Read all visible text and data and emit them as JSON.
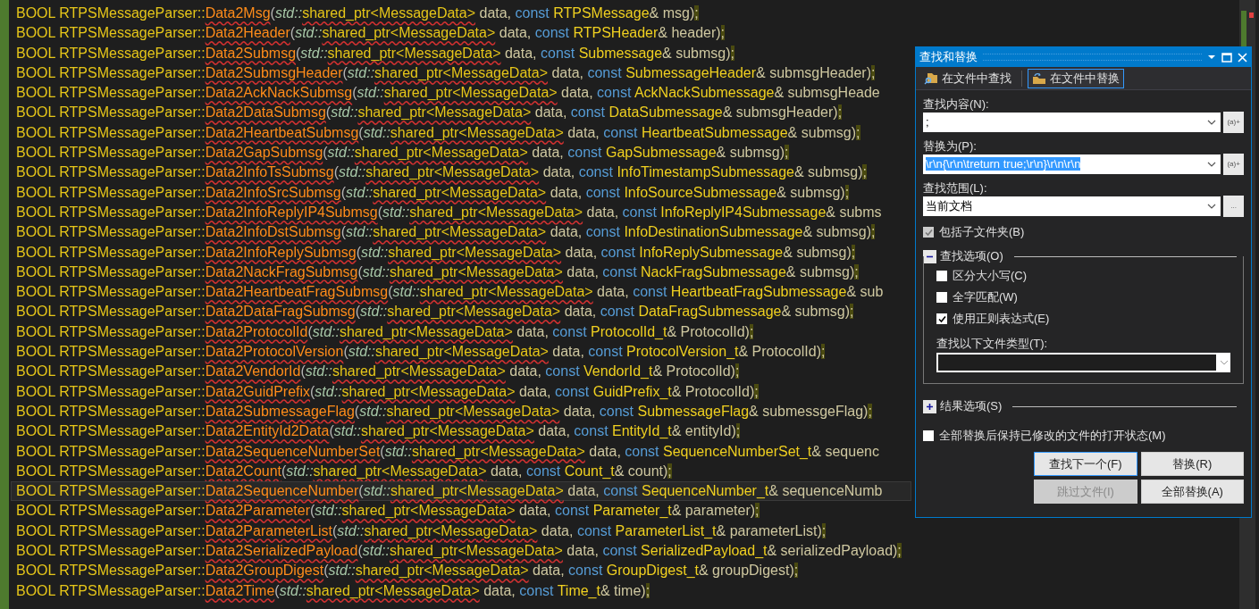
{
  "code_lines": [
    {
      "head": "BOOL RTPSMessageParser::",
      "name": "Data2Msg",
      "open": "(",
      "ns": "std::",
      "ptr": "shared_ptr<MessageData>",
      "mid": " data, ",
      "kw": "const",
      "type": "RTPSMessage",
      "tail": "& msg)",
      "semi": ";",
      "current": false
    },
    {
      "head": "BOOL RTPSMessageParser::",
      "name": "Data2Header",
      "open": "(",
      "ns": "std::",
      "ptr": "shared_ptr<MessageData>",
      "mid": " data, ",
      "kw": "const",
      "type": "RTPSHeader",
      "tail": "& header)",
      "semi": ";",
      "current": false
    },
    {
      "head": "BOOL RTPSMessageParser::",
      "name": "Data2Submsg",
      "open": "(",
      "ns": "std::",
      "ptr": "shared_ptr<MessageData>",
      "mid": " data, ",
      "kw": "const",
      "type": "Submessage",
      "tail": "& submsg)",
      "semi": ";",
      "current": false
    },
    {
      "head": "BOOL RTPSMessageParser::",
      "name": "Data2SubmsgHeader",
      "open": "(",
      "ns": "std::",
      "ptr": "shared_ptr<MessageData>",
      "mid": " data, ",
      "kw": "const",
      "type": "SubmessageHeader",
      "tail": "& submsgHeader)",
      "semi": ";",
      "current": false
    },
    {
      "head": "BOOL RTPSMessageParser::",
      "name": "Data2AckNackSubmsg",
      "open": "(",
      "ns": "std::",
      "ptr": "shared_ptr<MessageData>",
      "mid": " data, ",
      "kw": "const",
      "type": "AckNackSubmessage",
      "tail": "& submsgHeade",
      "current": false
    },
    {
      "head": "BOOL RTPSMessageParser::",
      "name": "Data2DataSubmsg",
      "open": "(",
      "ns": "std::",
      "ptr": "shared_ptr<MessageData>",
      "mid": " data, ",
      "kw": "const",
      "type": "DataSubmessage",
      "tail": "& submsgHeader)",
      "semi": ";",
      "current": false
    },
    {
      "head": "BOOL RTPSMessageParser::",
      "name": "Data2HeartbeatSubmsg",
      "open": "(",
      "ns": "std::",
      "ptr": "shared_ptr<MessageData>",
      "mid": " data, ",
      "kw": "const",
      "type": "HeartbeatSubmessage",
      "tail": "& submsg)",
      "semi": ";",
      "current": false
    },
    {
      "head": "BOOL RTPSMessageParser::",
      "name": "Data2GapSubmsg",
      "open": "(",
      "ns": "std::",
      "ptr": "shared_ptr<MessageData>",
      "mid": " data, ",
      "kw": "const",
      "type": "GapSubmessage",
      "tail": "& submsg)",
      "semi": ";",
      "current": false
    },
    {
      "head": "BOOL RTPSMessageParser::",
      "name": "Data2InfoTsSubmsg",
      "open": "(",
      "ns": "std::",
      "ptr": "shared_ptr<MessageData>",
      "mid": " data, ",
      "kw": "const",
      "type": "InfoTimestampSubmessage",
      "tail": "& submsg)",
      "semi": ";",
      "current": false
    },
    {
      "head": "BOOL RTPSMessageParser::",
      "name": "Data2InfoSrcSubmsg",
      "open": "(",
      "ns": "std::",
      "ptr": "shared_ptr<MessageData>",
      "mid": " data, ",
      "kw": "const",
      "type": "InfoSourceSubmessage",
      "tail": "& submsg)",
      "semi": ";",
      "current": false
    },
    {
      "head": "BOOL RTPSMessageParser::",
      "name": "Data2InfoReplyIP4Submsg",
      "open": "(",
      "ns": "std::",
      "ptr": "shared_ptr<MessageData>",
      "mid": " data, ",
      "kw": "const",
      "type": "InfoReplyIP4Submessage",
      "tail": "& subms",
      "current": false
    },
    {
      "head": "BOOL RTPSMessageParser::",
      "name": "Data2InfoDstSubmsg",
      "open": "(",
      "ns": "std::",
      "ptr": "shared_ptr<MessageData>",
      "mid": " data, ",
      "kw": "const",
      "type": "InfoDestinationSubmessage",
      "tail": "& submsg)",
      "semi": ";",
      "current": false
    },
    {
      "head": "BOOL RTPSMessageParser::",
      "name": "Data2InfoReplySubmsg",
      "open": "(",
      "ns": "std::",
      "ptr": "shared_ptr<MessageData>",
      "mid": " data, ",
      "kw": "const",
      "type": "InfoReplySubmessage",
      "tail": "& submsg)",
      "semi": ";",
      "current": false
    },
    {
      "head": "BOOL RTPSMessageParser::",
      "name": "Data2NackFragSubmsg",
      "open": "(",
      "ns": "std::",
      "ptr": "shared_ptr<MessageData>",
      "mid": " data, ",
      "kw": "const",
      "type": "NackFragSubmessage",
      "tail": "& submsg)",
      "semi": ";",
      "current": false
    },
    {
      "head": "BOOL RTPSMessageParser::",
      "name": "Data2HeartbeatFragSubmsg",
      "open": "(",
      "ns": "std::",
      "ptr": "shared_ptr<MessageData>",
      "mid": " data, ",
      "kw": "const",
      "type": "HeartbeatFragSubmessage",
      "tail": "& sub",
      "current": false
    },
    {
      "head": "BOOL RTPSMessageParser::",
      "name": "Data2DataFragSubmsg",
      "open": "(",
      "ns": "std::",
      "ptr": "shared_ptr<MessageData>",
      "mid": " data, ",
      "kw": "const",
      "type": "DataFragSubmessage",
      "tail": "& submsg)",
      "semi": ";",
      "current": false
    },
    {
      "head": "BOOL RTPSMessageParser::",
      "name": "Data2ProtocolId",
      "open": "(",
      "ns": "std::",
      "ptr": "shared_ptr<MessageData>",
      "mid": " data, ",
      "kw": "const",
      "type": "ProtocolId_t",
      "tail": "& ProtocolId)",
      "semi": ";",
      "current": false
    },
    {
      "head": "BOOL RTPSMessageParser::",
      "name": "Data2ProtocolVersion",
      "open": "(",
      "ns": "std::",
      "ptr": "shared_ptr<MessageData>",
      "mid": " data, ",
      "kw": "const",
      "type": "ProtocolVersion_t",
      "tail": "& ProtocolId)",
      "semi": ";",
      "current": false
    },
    {
      "head": "BOOL RTPSMessageParser::",
      "name": "Data2VendorId",
      "open": "(",
      "ns": "std::",
      "ptr": "shared_ptr<MessageData>",
      "mid": " data, ",
      "kw": "const",
      "type": "VendorId_t",
      "tail": "& ProtocolId)",
      "semi": ";",
      "current": false
    },
    {
      "head": "BOOL RTPSMessageParser::",
      "name": "Data2GuidPrefix",
      "open": "(",
      "ns": "std::",
      "ptr": "shared_ptr<MessageData>",
      "mid": " data, ",
      "kw": "const",
      "type": "GuidPrefix_t",
      "tail": "& ProtocolId)",
      "semi": ";",
      "current": false
    },
    {
      "head": "BOOL RTPSMessageParser::",
      "name": "Data2SubmessageFlag",
      "open": "(",
      "ns": "std::",
      "ptr": "shared_ptr<MessageData>",
      "mid": " data, ",
      "kw": "const",
      "type": "SubmessageFlag",
      "tail": "& submessgeFlag)",
      "semi": ";",
      "current": false
    },
    {
      "head": "BOOL RTPSMessageParser::",
      "name": "Data2EntityId2Data",
      "open": "(",
      "ns": "std::",
      "ptr": "shared_ptr<MessageData>",
      "mid": " data, ",
      "kw": "const",
      "type": "EntityId_t",
      "tail": "& entityId)",
      "semi": ";",
      "current": false
    },
    {
      "head": "BOOL RTPSMessageParser::",
      "name": "Data2SequenceNumberSet",
      "open": "(",
      "ns": "std::",
      "ptr": "shared_ptr<MessageData>",
      "mid": " data, ",
      "kw": "const",
      "type": "SequenceNumberSet_t",
      "tail": "& sequenc",
      "current": false
    },
    {
      "head": "BOOL RTPSMessageParser::",
      "name": "Data2Count",
      "open": "(",
      "ns": "std::",
      "ptr": "shared_ptr<MessageData>",
      "mid": " data, ",
      "kw": "const",
      "type": "Count_t",
      "tail": "& count)",
      "semi": ";",
      "current": false
    },
    {
      "head": "BOOL RTPSMessageParser::",
      "name": "Data2SequenceNumber",
      "open": "(",
      "ns": "std::",
      "ptr": "shared_ptr<MessageData>",
      "mid": " data, ",
      "kw": "const",
      "type": "SequenceNumber_t",
      "tail": "& sequenceNumb",
      "current": true
    },
    {
      "head": "BOOL RTPSMessageParser::",
      "name": "Data2Parameter",
      "open": "(",
      "ns": "std::",
      "ptr": "shared_ptr<MessageData>",
      "mid": " data, ",
      "kw": "const",
      "type": "Parameter_t",
      "tail": "& parameter)",
      "semi": ";",
      "current": false
    },
    {
      "head": "BOOL RTPSMessageParser::",
      "name": "Data2ParameterList",
      "open": "(",
      "ns": "std::",
      "ptr": "shared_ptr<MessageData>",
      "mid": " data, ",
      "kw": "const",
      "type": "ParameterList_t",
      "tail": "& parameterList)",
      "semi": ";",
      "current": false
    },
    {
      "head": "BOOL RTPSMessageParser::",
      "name": "Data2SerializedPayload",
      "open": "(",
      "ns": "std::",
      "ptr": "shared_ptr<MessageData>",
      "mid": " data, ",
      "kw": "const",
      "type": "SerializedPayload_t",
      "tail": "& serializedPayload)",
      "semi": ";",
      "current": false
    },
    {
      "head": "BOOL RTPSMessageParser::",
      "name": "Data2GroupDigest",
      "open": "(",
      "ns": "std::",
      "ptr": "shared_ptr<MessageData>",
      "mid": " data, ",
      "kw": "const",
      "type": "GroupDigest_t",
      "tail": "& groupDigest)",
      "semi": ";",
      "current": false
    },
    {
      "head": "BOOL RTPSMessageParser::",
      "name": "Data2Time",
      "open": "(",
      "ns": "std::",
      "ptr": "shared_ptr<MessageData>",
      "mid": " data, ",
      "kw": "const",
      "type": "Time_t",
      "tail": "& time)",
      "semi": ";",
      "current": false
    }
  ],
  "dialog": {
    "title": "查找和替换",
    "tabs": [
      {
        "label": "在文件中查找",
        "selected": false
      },
      {
        "label": "在文件中替换",
        "selected": true
      }
    ],
    "find": {
      "label": "查找内容(N):",
      "value": ";",
      "button": "(a)+"
    },
    "replace": {
      "label": "替换为(P):",
      "value": "\\r\\n{\\r\\n\\treturn true;\\r\\n}\\r\\n\\r\\n",
      "button": "(a)+"
    },
    "scope": {
      "label": "查找范围(L):",
      "value": "当前文档",
      "button": "..."
    },
    "include_subfolders": {
      "label": "包括子文件夹(B)",
      "checked": true,
      "disabled": true
    },
    "find_options": {
      "label": "查找选项(O)",
      "expanded": true,
      "options": [
        {
          "label": "区分大小写(C)",
          "checked": false
        },
        {
          "label": "全字匹配(W)",
          "checked": false
        },
        {
          "label": "使用正则表达式(E)",
          "checked": true
        }
      ],
      "file_types_label": "查找以下文件类型(T):"
    },
    "result_options": {
      "label": "结果选项(S)",
      "expanded": false
    },
    "keep_open": {
      "label": "全部替换后保持已修改的文件的打开状态(M)",
      "checked": false
    },
    "buttons": [
      {
        "label": "查找下一个(F)",
        "focused": true,
        "disabled": false
      },
      {
        "label": "替换(R)",
        "focused": false,
        "disabled": false
      },
      {
        "label": "跳过文件(I)",
        "focused": false,
        "disabled": true
      },
      {
        "label": "全部替换(A)",
        "focused": false,
        "disabled": false
      }
    ]
  }
}
